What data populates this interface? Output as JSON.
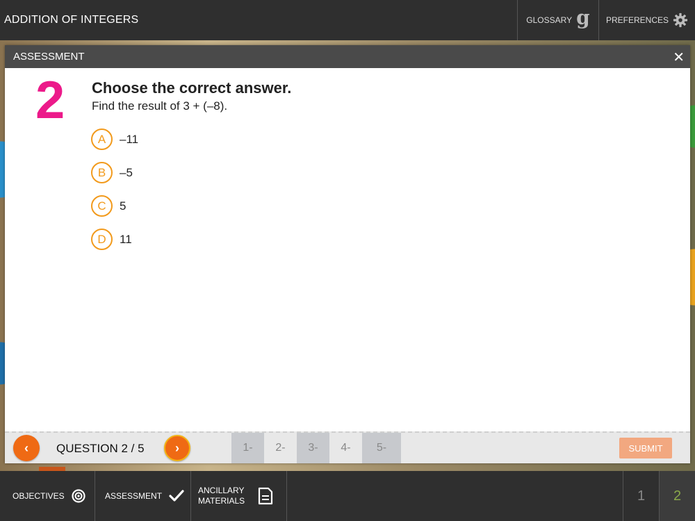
{
  "app": {
    "title": "ADDITION OF INTEGERS"
  },
  "topbar": {
    "glossary_label": "GLOSSARY",
    "glossary_icon": "g",
    "preferences_label": "PREFERENCES"
  },
  "modal": {
    "title": "ASSESSMENT",
    "close_symbol": "✕"
  },
  "question": {
    "number": "2",
    "heading": "Choose the correct answer.",
    "prompt": "Find the result of 3 + (–8).",
    "options": [
      {
        "letter": "A",
        "text": "–11"
      },
      {
        "letter": "B",
        "text": "–5"
      },
      {
        "letter": "C",
        "text": "5"
      },
      {
        "letter": "D",
        "text": "11"
      }
    ]
  },
  "footer": {
    "prev_symbol": "‹",
    "next_symbol": "›",
    "counter": "QUESTION 2 / 5",
    "dots": [
      "1-",
      "2-",
      "3-",
      "4-",
      "5-"
    ],
    "submit_label": "SUBMIT"
  },
  "bottombar": {
    "objectives_label": "OBJECTIVES",
    "assessment_label": "ASSESSMENT",
    "ancillary_label": "ANCILLARY MATERIALS",
    "pages": [
      "1",
      "2"
    ],
    "active_page": "2"
  },
  "colors": {
    "accent_orange": "#ef6a14",
    "question_number": "#ec1a8a",
    "option_ring": "#f29a1c",
    "active_page": "#8aa84a"
  }
}
